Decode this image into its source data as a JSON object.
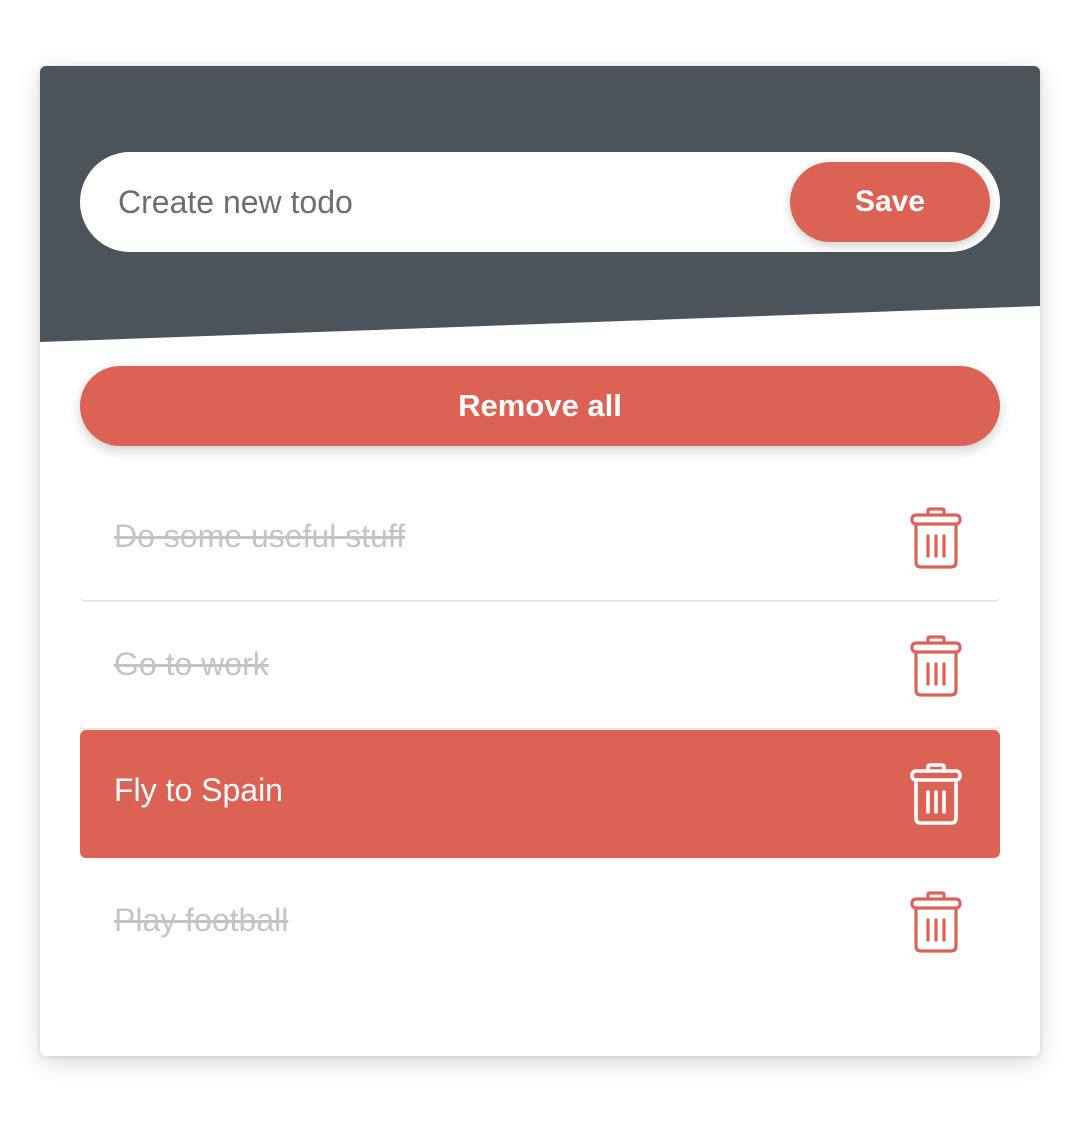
{
  "colors": {
    "header": "#4c545b",
    "accent": "#dc6254",
    "done_text": "#c4c4c4",
    "active_text": "#ffffff"
  },
  "new_todo": {
    "placeholder": "Create new todo",
    "value": ""
  },
  "buttons": {
    "save_label": "Save",
    "remove_all_label": "Remove all"
  },
  "todos": [
    {
      "text": "Do some useful stuff",
      "completed": true,
      "selected": false,
      "delete_icon": "trash-icon"
    },
    {
      "text": "Go to work",
      "completed": true,
      "selected": false,
      "delete_icon": "trash-icon"
    },
    {
      "text": "Fly to Spain",
      "completed": false,
      "selected": true,
      "delete_icon": "trash-icon"
    },
    {
      "text": "Play football",
      "completed": true,
      "selected": false,
      "delete_icon": "trash-icon"
    }
  ]
}
